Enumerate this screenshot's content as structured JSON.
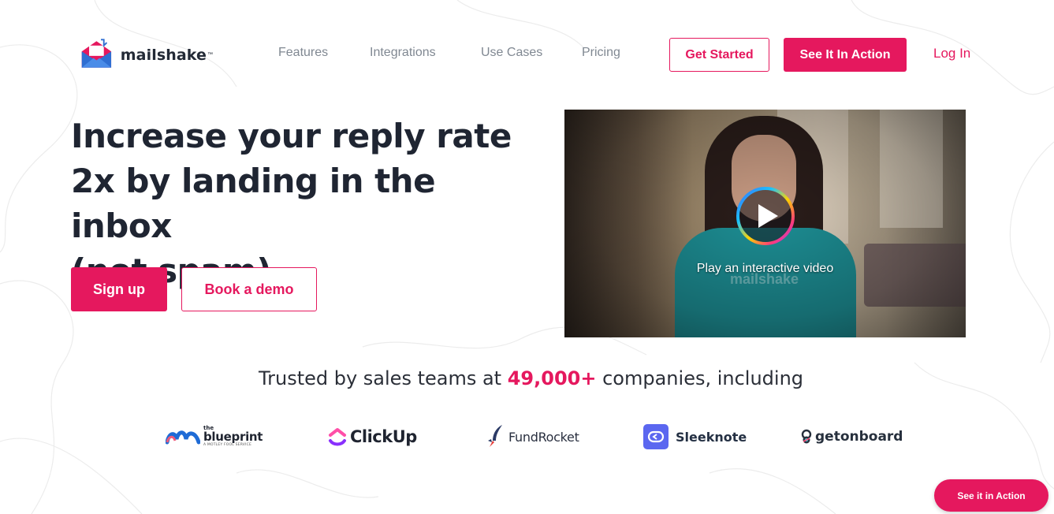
{
  "brand": {
    "name": "mailshake",
    "tm": "™",
    "accent_color": "#e5185e",
    "logo_icon": "mailshake-envelope-logo-icon"
  },
  "nav": {
    "links": [
      "Features",
      "Integrations",
      "Use Cases",
      "Pricing"
    ],
    "get_started": "Get Started",
    "see_in_action": "See It In Action",
    "login": "Log In"
  },
  "hero": {
    "headline": [
      "Increase your reply rate",
      "2x by landing in the inbox",
      "(not spam)."
    ],
    "signup": "Sign up",
    "book_demo": "Book a demo"
  },
  "video": {
    "caption": "Play an interactive video",
    "play_icon": "play-icon",
    "shirt_text": "mailshake"
  },
  "trusted": {
    "prefix": "Trusted by sales teams at",
    "count": "49,000+",
    "suffix": "companies, including"
  },
  "logos": {
    "blueprint": {
      "the": "the",
      "name": "blueprint",
      "tagline": "A MOTLEY FOOL SERVICE"
    },
    "clickup": "ClickUp",
    "fundrocket": "FundRocket",
    "sleeknote": "Sleeknote",
    "getonboard": "getonboard"
  },
  "floating_button": "See it in Action"
}
